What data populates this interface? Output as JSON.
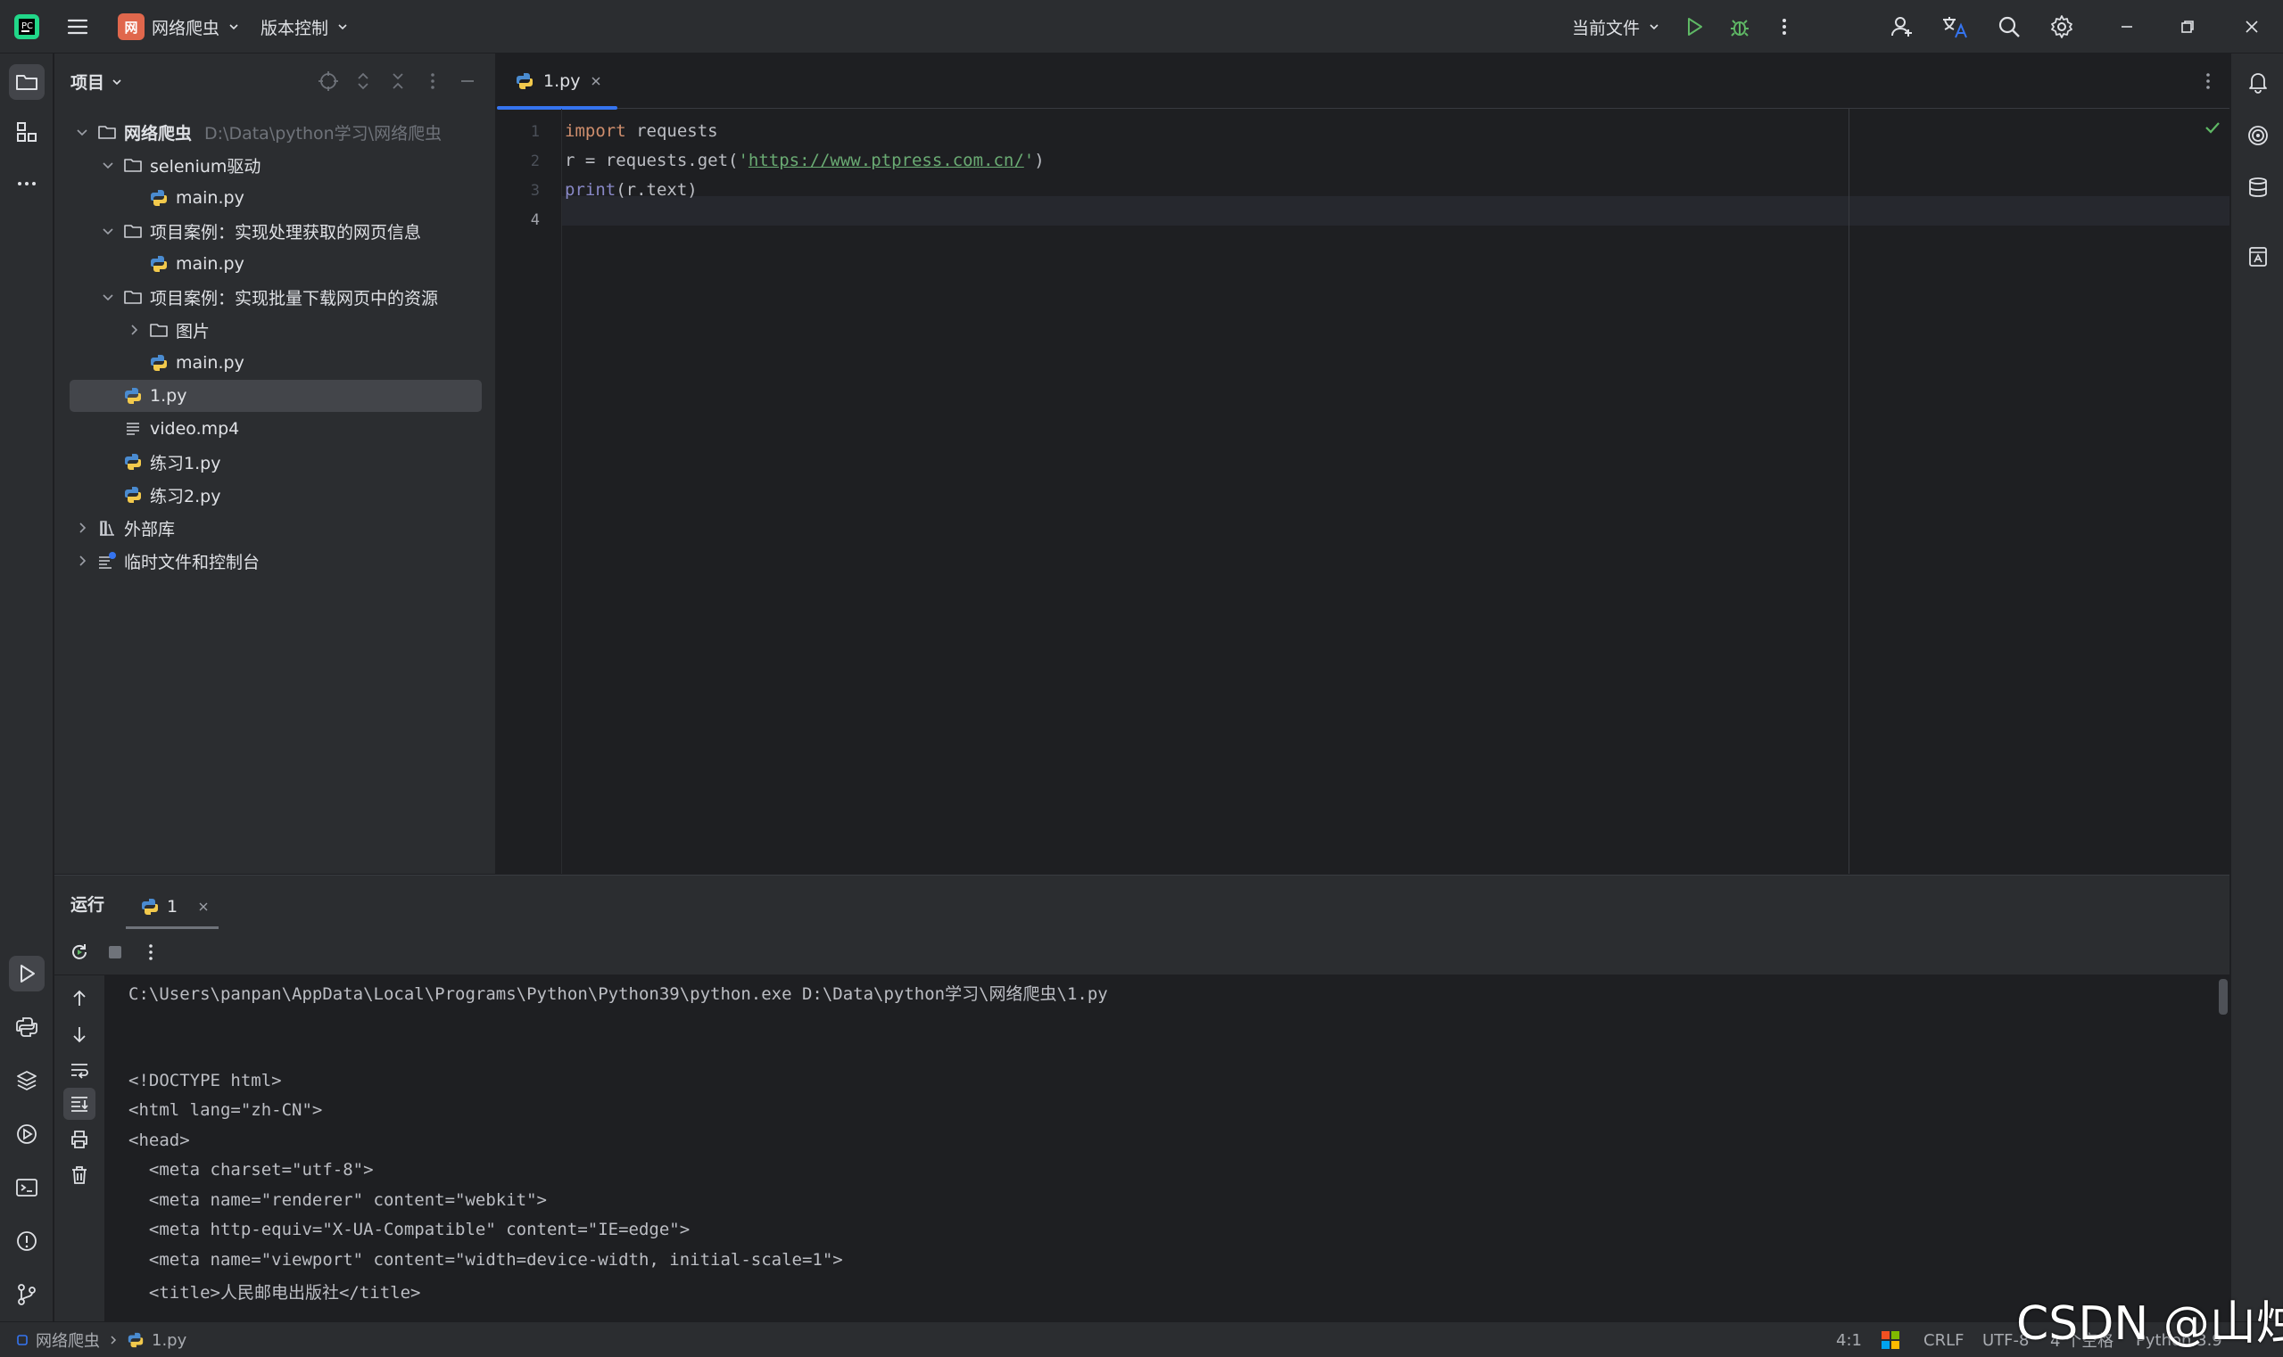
{
  "titlebar": {
    "project_badge": "网",
    "project_name": "网络爬虫",
    "vcs": "版本控制",
    "run_config": "当前文件"
  },
  "project_panel": {
    "title": "项目",
    "tree": [
      {
        "label": "网络爬虫",
        "hint": "D:\\Data\\python学习\\网络爬虫",
        "type": "folder",
        "expanded": true,
        "depth": 0
      },
      {
        "label": "selenium驱动",
        "type": "folder",
        "expanded": true,
        "depth": 1
      },
      {
        "label": "main.py",
        "type": "python",
        "depth": 2
      },
      {
        "label": "项目案例：实现处理获取的网页信息",
        "type": "folder",
        "expanded": true,
        "depth": 1
      },
      {
        "label": "main.py",
        "type": "python",
        "depth": 2
      },
      {
        "label": "项目案例：实现批量下载网页中的资源",
        "type": "folder",
        "expanded": true,
        "depth": 1
      },
      {
        "label": "图片",
        "type": "folder",
        "expanded": false,
        "depth": 2
      },
      {
        "label": "main.py",
        "type": "python",
        "depth": 2
      },
      {
        "label": "1.py",
        "type": "python",
        "depth": 1,
        "selected": true
      },
      {
        "label": "video.mp4",
        "type": "text",
        "depth": 1
      },
      {
        "label": "练习1.py",
        "type": "python",
        "depth": 1
      },
      {
        "label": "练习2.py",
        "type": "python",
        "depth": 1
      },
      {
        "label": "外部库",
        "type": "library",
        "expanded": false,
        "depth": 0
      },
      {
        "label": "临时文件和控制台",
        "type": "scratch",
        "expanded": false,
        "depth": 0
      }
    ]
  },
  "editor": {
    "tab_label": "1.py",
    "line_numbers": [
      "1",
      "2",
      "3",
      "4"
    ],
    "code": {
      "l1_kw": "import",
      "l1_rest": " requests",
      "l2_pre": "r = requests.get(",
      "l2_q1": "'",
      "l2_url": "https://www.ptpress.com.cn/",
      "l2_q2": "'",
      "l2_post": ")",
      "l3_fn": "print",
      "l3_rest": "(r.text)"
    }
  },
  "run_panel": {
    "title": "运行",
    "tab_label": "1",
    "output": [
      "C:\\Users\\panpan\\AppData\\Local\\Programs\\Python\\Python39\\python.exe D:\\Data\\python学习\\网络爬虫\\1.py",
      "",
      "",
      "<!DOCTYPE html>",
      "<html lang=\"zh-CN\">",
      "<head>",
      "  <meta charset=\"utf-8\">",
      "  <meta name=\"renderer\" content=\"webkit\">",
      "  <meta http-equiv=\"X-UA-Compatible\" content=\"IE=edge\">",
      "  <meta name=\"viewport\" content=\"width=device-width, initial-scale=1\">",
      "  <title>人民邮电出版社</title>"
    ]
  },
  "statusbar": {
    "crumb_project": "网络爬虫",
    "crumb_file": "1.py",
    "position": "4:1",
    "line_sep": "CRLF",
    "encoding": "UTF-8",
    "indent": "4 个空格",
    "interpreter": "Python 3.9"
  },
  "watermark": "CSDN @山烛",
  "colors": {
    "accent": "#3574f0",
    "keyword": "#cf8e6d",
    "string": "#6aab73",
    "run_green": "#5fb865"
  }
}
